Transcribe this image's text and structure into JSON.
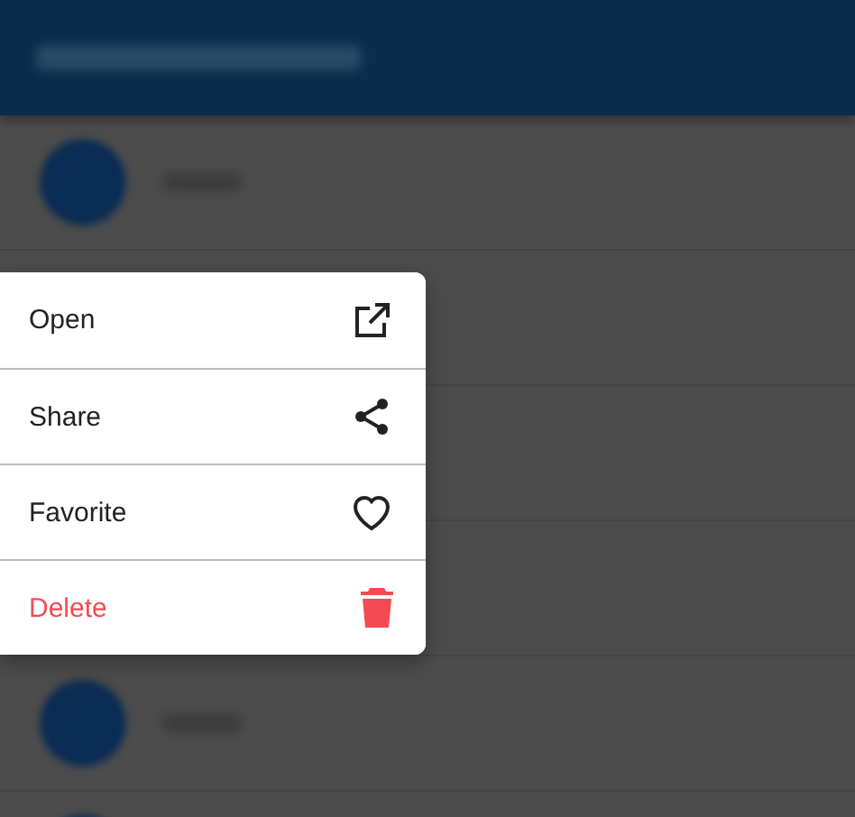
{
  "background_list": [
    {
      "kind": "avatar-row"
    },
    {
      "kind": "covered-row"
    },
    {
      "kind": "covered-row"
    },
    {
      "kind": "covered-row"
    },
    {
      "kind": "avatar-row"
    },
    {
      "kind": "avatar-row"
    }
  ],
  "menu": [
    {
      "label": "Open",
      "kind": "open"
    },
    {
      "label": "Share",
      "kind": "share"
    },
    {
      "label": "Favorite",
      "kind": "favorite"
    },
    {
      "label": "Delete",
      "kind": "delete"
    }
  ]
}
